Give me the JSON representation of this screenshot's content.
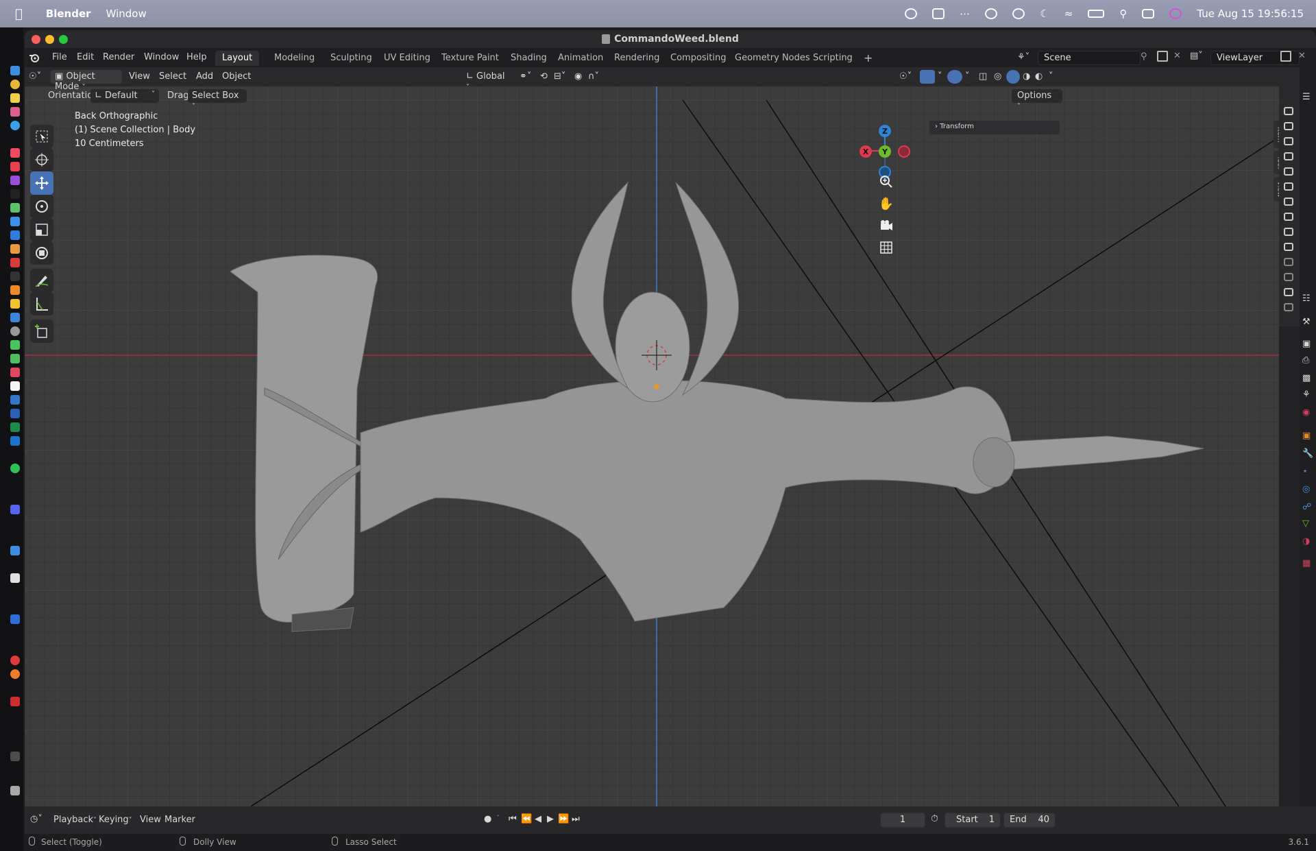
{
  "macos": {
    "app_name": "Blender",
    "menu_window": "Window",
    "clock": "Tue Aug 15  19:56:15"
  },
  "window": {
    "title": "CommandoWeed.blend"
  },
  "topbar": {
    "menus": [
      "File",
      "Edit",
      "Render",
      "Window",
      "Help"
    ],
    "workspaces": [
      "Layout",
      "Modeling",
      "Sculpting",
      "UV Editing",
      "Texture Paint",
      "Shading",
      "Animation",
      "Rendering",
      "Compositing",
      "Geometry Nodes",
      "Scripting"
    ],
    "add_tab": "+",
    "scene": "Scene",
    "view_layer": "ViewLayer"
  },
  "header": {
    "mode": "Object Mode",
    "menus": [
      "View",
      "Select",
      "Add",
      "Object"
    ],
    "transform_orientation": "Global",
    "options": "Options"
  },
  "tool_settings": {
    "orientation_label": "Orientation:",
    "orientation_value": "Default",
    "drag_label": "Drag:",
    "drag_value": "Select Box"
  },
  "viewport": {
    "view_name": "Back Orthographic",
    "collection": "(1) Scene Collection | Body",
    "scale": "10 Centimeters",
    "transform_panel": "Transform",
    "side_tabs": [
      "Item",
      "Tool",
      "View"
    ],
    "gizmo": {
      "z": "Z",
      "y": "Y",
      "x": "X"
    }
  },
  "timeline": {
    "menus": [
      "Playback",
      "Keying",
      "View",
      "Marker"
    ],
    "current_frame": "1",
    "start_label": "Start",
    "start_value": "1",
    "end_label": "End",
    "end_value": "40"
  },
  "statusbar": {
    "hint_left": "Select (Toggle)",
    "hint_mid": "Dolly View",
    "hint_right": "Lasso Select",
    "version": "3.6.1"
  },
  "colors": {
    "accent": "#4772b3",
    "axis_x": "#e0384f",
    "axis_y": "#6cbc2a",
    "axis_z": "#2f83d4"
  }
}
